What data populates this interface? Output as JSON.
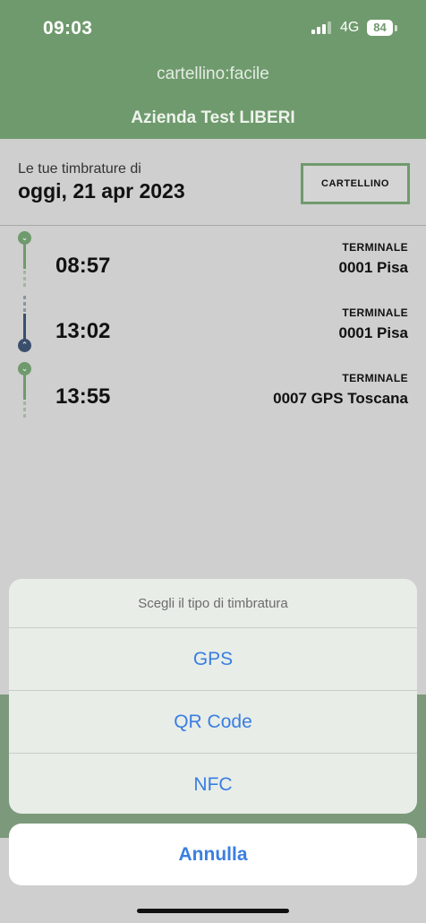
{
  "status_bar": {
    "time": "09:03",
    "network": "4G",
    "battery": "84"
  },
  "header": {
    "app_title": "cartellino:facile",
    "company": "Azienda Test LIBERI"
  },
  "day": {
    "label": "Le tue timbrature di",
    "date": "oggi, 21 apr 2023",
    "card_button": "CARTELLINO"
  },
  "entries": [
    {
      "time": "08:57",
      "terminal_label": "TERMINALE",
      "terminal": "0001 Pisa",
      "direction": "in"
    },
    {
      "time": "13:02",
      "terminal_label": "TERMINALE",
      "terminal": "0001 Pisa",
      "direction": "out"
    },
    {
      "time": "13:55",
      "terminal_label": "TERMINALE",
      "terminal": "0007 GPS Toscana",
      "direction": "in"
    }
  ],
  "action_sheet": {
    "title": "Scegli il tipo di timbratura",
    "options": [
      "GPS",
      "QR Code",
      "NFC"
    ],
    "cancel": "Annulla"
  },
  "colors": {
    "brand_green": "#6f9a6d",
    "out_blue": "#3b4f6d",
    "ios_blue": "#3a7ee0"
  }
}
